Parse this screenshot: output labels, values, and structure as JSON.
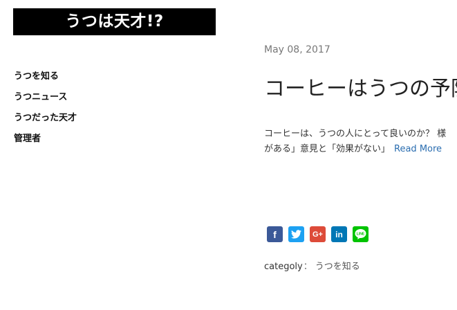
{
  "site": {
    "title": "うつは天才!?"
  },
  "nav": {
    "items": [
      {
        "label": "うつを知る"
      },
      {
        "label": "うつニュース"
      },
      {
        "label": "うつだった天才"
      },
      {
        "label": "管理者"
      }
    ]
  },
  "post": {
    "date": "May 08, 2017",
    "title": "コーヒーはうつの予防",
    "excerpt_line1": "コーヒーは、うつの人にとって良いのか？ 様",
    "excerpt_line2": "がある」意見と「効果がない」",
    "read_more": "Read More"
  },
  "share": {
    "buttons": [
      {
        "network": "facebook",
        "glyph": "f",
        "color": "#3b5998"
      },
      {
        "network": "twitter",
        "icon": "twitter-bird-icon",
        "color": "#1da1f2"
      },
      {
        "network": "google-plus",
        "glyph": "G+",
        "color": "#dd4b39"
      },
      {
        "network": "linkedin",
        "glyph": "in",
        "color": "#0077b5"
      },
      {
        "network": "line",
        "glyph": "LINE",
        "color": "#00c300"
      }
    ]
  },
  "meta": {
    "category_label": "categoly",
    "category_sep": "：",
    "category_value": "うつを知る"
  }
}
